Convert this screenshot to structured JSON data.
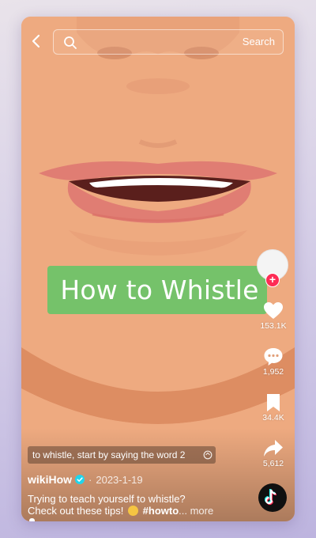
{
  "search": {
    "placeholder": "",
    "button_label": "Search"
  },
  "video": {
    "title_overlay": "How to Whistle",
    "caption": "to whistle, start by saying the word 2",
    "author": "wikiHow",
    "date_separator": "·",
    "date": "2023-1-19",
    "description_line1": "Trying to teach yourself to whistle?",
    "description_line2_start": "Check out these tips!",
    "hashtag": "#howto",
    "ellipsis_more": "... more"
  },
  "actions": {
    "likes": "153.1K",
    "comments": "1,952",
    "saves": "34.4K",
    "shares": "5,612"
  },
  "colors": {
    "skin": "#eeaa80",
    "lips": "#e07d73",
    "banner": "#75c26a",
    "follow_badge": "#fe2c55"
  },
  "icons": [
    "back-arrow-icon",
    "search-icon",
    "heart-icon",
    "comment-icon",
    "bookmark-icon",
    "share-arrow-icon",
    "verified-icon",
    "translate-icon",
    "tiktok-logo-icon"
  ]
}
